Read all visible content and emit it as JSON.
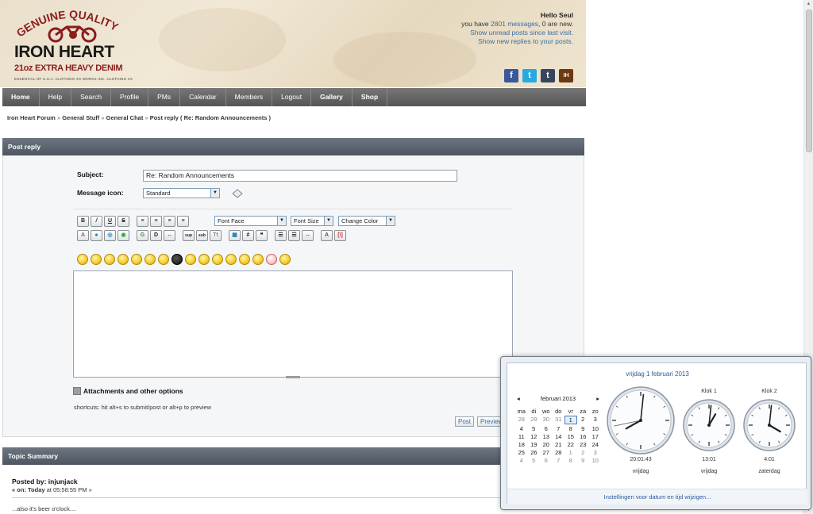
{
  "brand": {
    "arc_text": "GENUINE QUALITY",
    "name": "IRON HEART",
    "tagline": "21oz EXTRA HEAVY DENIM",
    "fine_print": "ESSENTIAL OF U.S.A. CLOTHING   XX WORKS INC. CLOTHING XX"
  },
  "user": {
    "greeting": "Hello Seul",
    "messages_prefix": "you have",
    "messages_link": "2801 messages",
    "messages_suffix": ", 0 are new.",
    "unread_link": "Show unread posts since last visit.",
    "replies_link": "Show new replies to your posts."
  },
  "social": [
    {
      "icon": "facebook-icon",
      "glyph": "f",
      "color": "#3b5998"
    },
    {
      "icon": "twitter-icon",
      "glyph": "t",
      "color": "#2aa9e0"
    },
    {
      "icon": "tumblr-icon",
      "glyph": "t",
      "color": "#36465d"
    },
    {
      "icon": "blog-icon",
      "glyph": "IH",
      "color": "#6b3a12"
    }
  ],
  "nav": [
    "Home",
    "Help",
    "Search",
    "Profile",
    "PMs",
    "Calendar",
    "Members",
    "Logout",
    "Gallery",
    "Shop"
  ],
  "breadcrumb": {
    "items": [
      "Iron Heart Forum",
      "General Stuff",
      "General Chat"
    ],
    "separator": "»",
    "current": "Post reply ( Re: Random Announcements )"
  },
  "post_reply": {
    "header": "Post reply",
    "subject_label": "Subject:",
    "subject_value": "Re: Random Announcements",
    "icon_label": "Message icon:",
    "icon_value": "Standard",
    "font_face": "Font Face",
    "font_size": "Font Size",
    "change_color": "Change Color",
    "toolbar_row1": [
      "B",
      "I",
      "U",
      "S",
      "",
      "",
      "",
      "",
      "",
      ""
    ],
    "attachments_label": "Attachments and other options",
    "shortcuts": "shortcuts: hit alt+s to submit/post or alt+p to preview",
    "post_button": "Post",
    "preview_button": "Preview"
  },
  "topic_summary": {
    "header": "Topic Summary",
    "posted_by": "Posted by: injunjack",
    "on_prefix": "« on:",
    "on_day": "Today",
    "on_time": "at 05:58:55 PM »",
    "body": "...also it's beer o'clock...."
  },
  "clock_popup": {
    "long_date": "vrijdag 1 februari 2013",
    "month_title": "februari 2013",
    "prev": "◂",
    "next": "▸",
    "weekdays": [
      "ma",
      "di",
      "wo",
      "do",
      "vr",
      "za",
      "zo"
    ],
    "weeks": [
      [
        "28",
        "29",
        "30",
        "31",
        "1",
        "2",
        "3"
      ],
      [
        "4",
        "5",
        "6",
        "7",
        "8",
        "9",
        "10"
      ],
      [
        "11",
        "12",
        "13",
        "14",
        "15",
        "16",
        "17"
      ],
      [
        "18",
        "19",
        "20",
        "21",
        "22",
        "23",
        "24"
      ],
      [
        "25",
        "26",
        "27",
        "28",
        "1",
        "2",
        "3"
      ],
      [
        "4",
        "5",
        "6",
        "7",
        "8",
        "9",
        "10"
      ]
    ],
    "today": "1",
    "clocks": [
      {
        "name": "",
        "time": "20:01:43",
        "day": "vrijdag",
        "hours": 20,
        "minutes": 1,
        "seconds": 43
      },
      {
        "name": "Klok 1",
        "time": "13:01",
        "day": "vrijdag",
        "hours": 13,
        "minutes": 1
      },
      {
        "name": "Klok 2",
        "time": "4:01",
        "day": "zaterdag",
        "hours": 4,
        "minutes": 1
      }
    ],
    "settings_link": "Instellingen voor datum en tijd wijzigen..."
  }
}
